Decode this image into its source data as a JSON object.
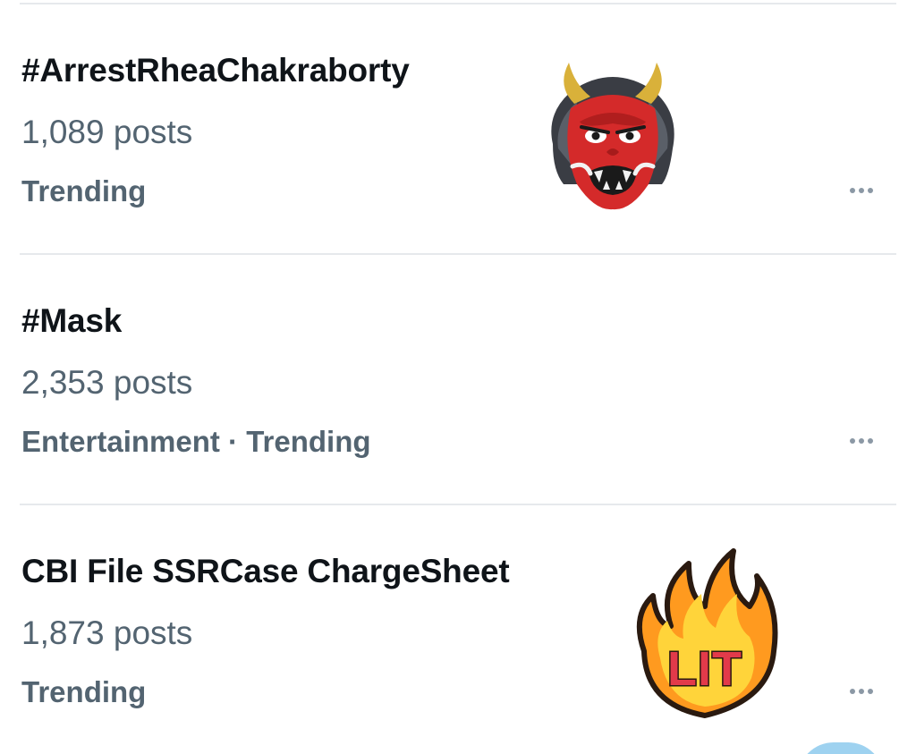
{
  "trends": [
    {
      "title": "#ArrestRheaChakraborty",
      "count": "1,089 posts",
      "context": "Trending",
      "emoji": "oni-mask-emoji",
      "more_icon": "more-options-icon"
    },
    {
      "title": "#Mask",
      "count": "2,353 posts",
      "context": "Entertainment · Trending",
      "emoji": "",
      "more_icon": "more-options-icon"
    },
    {
      "title": "CBI File SSRCase ChargeSheet",
      "count": "1,873 posts",
      "context": "Trending",
      "emoji": "lit-fire-emoji",
      "emoji_text": "LIT",
      "more_icon": "more-options-icon"
    }
  ],
  "colors": {
    "title": "#0f1419",
    "secondary": "#536471",
    "divider": "#e6e9ec",
    "more_dots": "#8b98a5"
  }
}
